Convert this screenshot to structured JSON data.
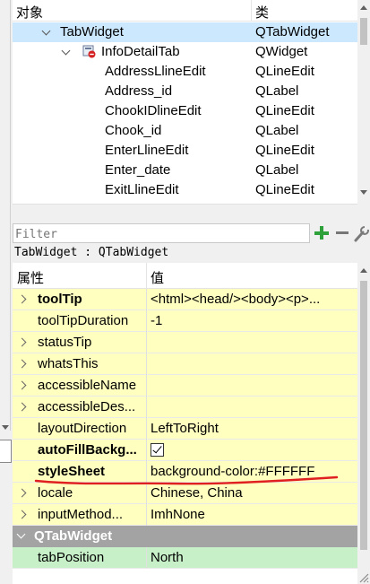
{
  "object_inspector": {
    "header": {
      "object_col": "对象",
      "class_col": "类"
    },
    "rows": [
      {
        "name": "TabWidget",
        "class": "QTabWidget",
        "selected": true
      },
      {
        "name": "InfoDetailTab",
        "class": "QWidget"
      },
      {
        "name": "AddressLlineEdit",
        "class": "QLineEdit"
      },
      {
        "name": "Address_id",
        "class": "QLabel"
      },
      {
        "name": "ChookIDlineEdit",
        "class": "QLineEdit"
      },
      {
        "name": "Chook_id",
        "class": "QLabel"
      },
      {
        "name": "EnterLlineEdit",
        "class": "QLineEdit"
      },
      {
        "name": "Enter_date",
        "class": "QLabel"
      },
      {
        "name": "ExitLlineEdit",
        "class": "QLineEdit"
      }
    ]
  },
  "filter": {
    "placeholder": "Filter"
  },
  "class_line": "TabWidget : QTabWidget",
  "property_editor": {
    "header": {
      "property_col": "属性",
      "value_col": "值"
    },
    "rows": [
      {
        "name": "toolTip",
        "value": "<html><head/><body><p>...",
        "bold": true
      },
      {
        "name": "toolTipDuration",
        "value": "-1"
      },
      {
        "name": "statusTip",
        "value": ""
      },
      {
        "name": "whatsThis",
        "value": ""
      },
      {
        "name": "accessibleName",
        "value": ""
      },
      {
        "name": "accessibleDes...",
        "value": ""
      },
      {
        "name": "layoutDirection",
        "value": "LeftToRight"
      },
      {
        "name": "autoFillBackg...",
        "value": "",
        "bold": true,
        "checked": true
      },
      {
        "name": "styleSheet",
        "value": "background-color:#FFFFFF",
        "bold": true
      },
      {
        "name": "locale",
        "value": "Chinese, China"
      },
      {
        "name": "inputMethod...",
        "value": "ImhNone"
      }
    ],
    "section": {
      "name": "QTabWidget"
    },
    "section_rows": [
      {
        "name": "tabPosition",
        "value": "North"
      }
    ]
  },
  "colors": {
    "property_row_bg": "#ffffc0",
    "section_bg": "#a3a3a3",
    "section_row_bg": "#c8f0c8",
    "selection_bg": "#cce8ff",
    "annotation_red": "#e02020",
    "add_button_green": "#2fa13a"
  },
  "icons": {
    "expand": "chevron-down-icon",
    "collapsed": "chevron-right-icon",
    "widget": "widget-no-layout-icon",
    "add": "plus-icon",
    "remove": "minus-icon",
    "tool": "wrench-icon"
  }
}
